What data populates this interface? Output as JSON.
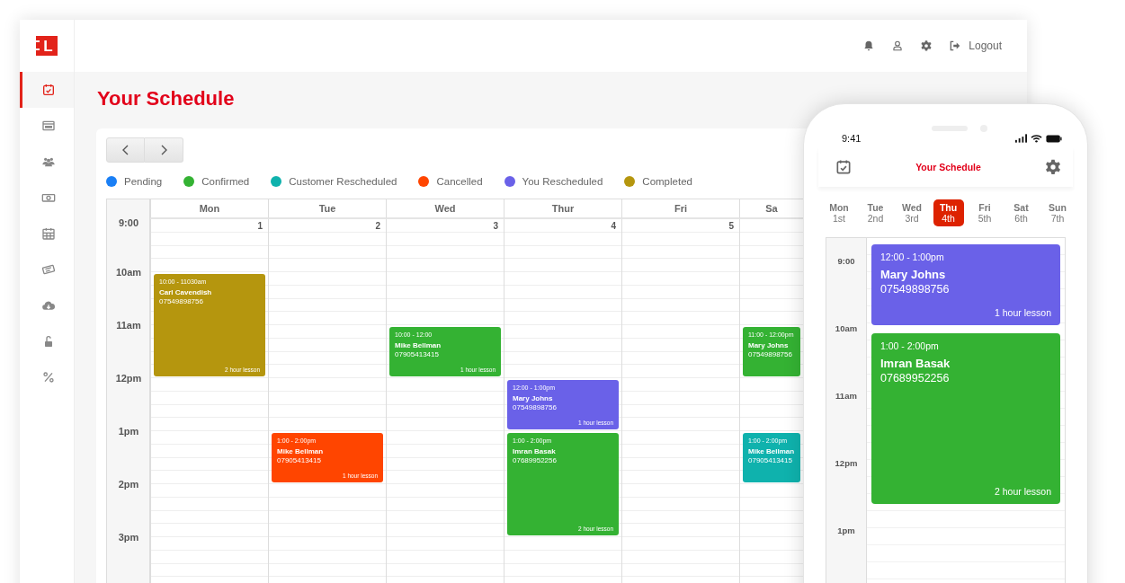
{
  "logo": {
    "text": "L"
  },
  "sidebar": {
    "items": [
      {
        "selected": true
      },
      {
        "selected": false
      },
      {
        "selected": false
      },
      {
        "selected": false
      },
      {
        "selected": false
      },
      {
        "selected": false
      },
      {
        "selected": false
      },
      {
        "selected": false
      },
      {
        "selected": false
      }
    ]
  },
  "top_bar": {
    "logout": "Logout"
  },
  "page_title": "Your Schedule",
  "legend": [
    {
      "label": "Pending",
      "color": "#1a7ff5"
    },
    {
      "label": "Confirmed",
      "color": "#34b233"
    },
    {
      "label": "Customer Rescheduled",
      "color": "#0fb2ad"
    },
    {
      "label": "Cancelled",
      "color": "#ff4500"
    },
    {
      "label": "You Rescheduled",
      "color": "#6a61e8"
    },
    {
      "label": "Completed",
      "color": "#b5960e"
    }
  ],
  "calendar": {
    "times": [
      "9:00",
      "10am",
      "11am",
      "12pm",
      "1pm",
      "2pm",
      "3pm"
    ],
    "days": [
      {
        "name": "Mon",
        "date": "1",
        "events": [
          {
            "time": "10:00 - 11030am",
            "name": "Carl Cavendish",
            "phone": "07549898756",
            "lesson": "2 hour lesson",
            "color": "#b5960e"
          }
        ]
      },
      {
        "name": "Tue",
        "date": "2",
        "events": [
          {
            "time": "1:00 - 2:00pm",
            "name": "Mike Bellman",
            "phone": "07905413415",
            "lesson": "1 hour lesson",
            "color": "#ff4500"
          }
        ]
      },
      {
        "name": "Wed",
        "date": "3",
        "events": [
          {
            "time": "10:00 - 12:00",
            "name": "Mike Bellman",
            "phone": "07905413415",
            "lesson": "1 hour lesson",
            "color": "#34b233"
          }
        ]
      },
      {
        "name": "Thur",
        "date": "4",
        "events": [
          {
            "time": "12:00 - 1:00pm",
            "name": "Mary Johns",
            "phone": "07549898756",
            "lesson": "1 hour lesson",
            "color": "#6a61e8"
          },
          {
            "time": "1:00 - 2:00pm",
            "name": "Imran Basak",
            "phone": "07689952256",
            "lesson": "2 hour lesson",
            "color": "#34b233"
          }
        ]
      },
      {
        "name": "Fri",
        "date": "5"
      },
      {
        "name": "Sa",
        "events": [
          {
            "time": "11:00 - 12:00pm",
            "name": "Mary Johns",
            "phone": "07549898756",
            "color": "#34b233"
          },
          {
            "time": "1:00 - 2:00pm",
            "name": "Mike Bellman",
            "phone": "07905413415",
            "color": "#0fb2ad"
          }
        ]
      }
    ]
  },
  "phone": {
    "time": "9:41",
    "title": "Your Schedule",
    "days": [
      {
        "name": "Mon",
        "date": "1st",
        "selected": false
      },
      {
        "name": "Tue",
        "date": "2nd",
        "selected": false
      },
      {
        "name": "Wed",
        "date": "3rd",
        "selected": false
      },
      {
        "name": "Thu",
        "date": "4th",
        "selected": true
      },
      {
        "name": "Fri",
        "date": "5th",
        "selected": false
      },
      {
        "name": "Sat",
        "date": "6th",
        "selected": false
      },
      {
        "name": "Sun",
        "date": "7th",
        "selected": false
      }
    ],
    "times": [
      "9:00",
      "10am",
      "11am",
      "12pm",
      "1pm"
    ],
    "events": [
      {
        "time": "12:00 - 1:00pm",
        "name": "Mary Johns",
        "phone": "07549898756",
        "lesson": "1 hour lesson",
        "color": "#6a61e8"
      },
      {
        "time": "1:00 - 2:00pm",
        "name": "Imran Basak",
        "phone": "07689952256",
        "lesson": "2 hour lesson",
        "color": "#34b233"
      }
    ]
  }
}
